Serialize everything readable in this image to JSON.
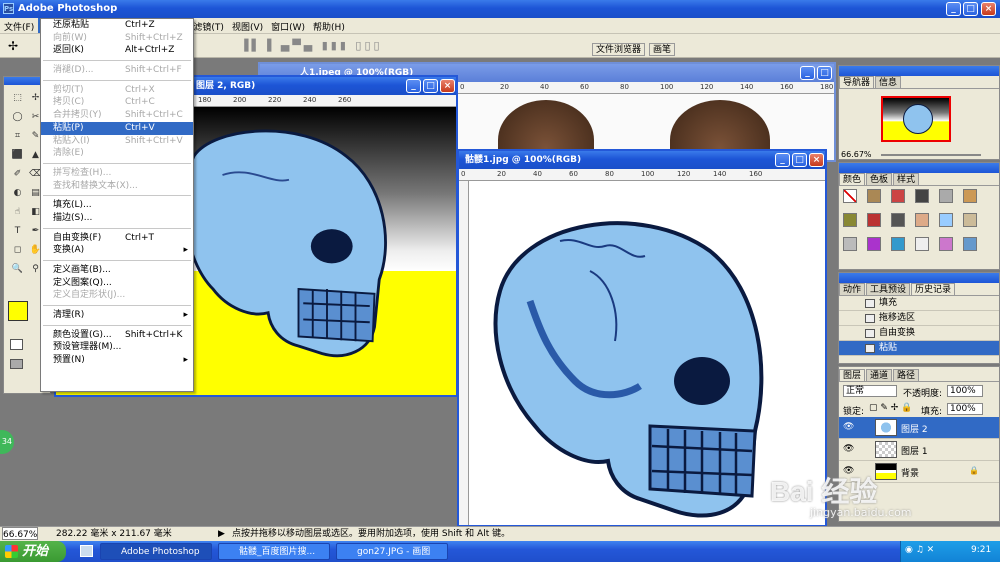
{
  "app": {
    "title": "Adobe Photoshop"
  },
  "menubar": {
    "items": [
      "文件(F)",
      "编辑(E)",
      "图像(I)",
      "图层(L)",
      "选择(S)",
      "滤镜(T)",
      "视图(V)",
      "窗口(W)",
      "帮助(H)"
    ]
  },
  "optbar": {
    "file_browser": "文件浏览器",
    "brushes": "画笔"
  },
  "edit_menu": {
    "items": [
      {
        "label": "还原粘贴",
        "shortcut": "Ctrl+Z",
        "state": "normal"
      },
      {
        "label": "向前(W)",
        "shortcut": "Shift+Ctrl+Z",
        "state": "disabled"
      },
      {
        "label": "返回(K)",
        "shortcut": "Alt+Ctrl+Z",
        "state": "normal"
      },
      {
        "sep": true
      },
      {
        "label": "消褪(D)...",
        "shortcut": "Shift+Ctrl+F",
        "state": "disabled"
      },
      {
        "sep": true
      },
      {
        "label": "剪切(T)",
        "shortcut": "Ctrl+X",
        "state": "disabled"
      },
      {
        "label": "拷贝(C)",
        "shortcut": "Ctrl+C",
        "state": "disabled"
      },
      {
        "label": "合并拷贝(Y)",
        "shortcut": "Shift+Ctrl+C",
        "state": "disabled"
      },
      {
        "label": "粘贴(P)",
        "shortcut": "Ctrl+V",
        "state": "highlight"
      },
      {
        "label": "粘贴入(I)",
        "shortcut": "Shift+Ctrl+V",
        "state": "disabled"
      },
      {
        "label": "清除(E)",
        "shortcut": "",
        "state": "disabled"
      },
      {
        "sep": true
      },
      {
        "label": "拼写检查(H)...",
        "shortcut": "",
        "state": "disabled"
      },
      {
        "label": "查找和替换文本(X)...",
        "shortcut": "",
        "state": "disabled"
      },
      {
        "sep": true
      },
      {
        "label": "填充(L)...",
        "shortcut": "",
        "state": "normal"
      },
      {
        "label": "描边(S)...",
        "shortcut": "",
        "state": "normal"
      },
      {
        "sep": true
      },
      {
        "label": "自由变换(F)",
        "shortcut": "Ctrl+T",
        "state": "normal"
      },
      {
        "label": "变换(A)",
        "shortcut": "",
        "state": "normal",
        "sub": true
      },
      {
        "sep": true
      },
      {
        "label": "定义画笔(B)...",
        "shortcut": "",
        "state": "normal"
      },
      {
        "label": "定义图案(Q)...",
        "shortcut": "",
        "state": "normal"
      },
      {
        "label": "定义自定形状(J)...",
        "shortcut": "",
        "state": "disabled"
      },
      {
        "sep": true
      },
      {
        "label": "清理(R)",
        "shortcut": "",
        "state": "normal",
        "sub": true
      },
      {
        "sep": true
      },
      {
        "label": "颜色设置(G)...",
        "shortcut": "Shift+Ctrl+K",
        "state": "normal"
      },
      {
        "label": "预设管理器(M)...",
        "shortcut": "",
        "state": "normal"
      },
      {
        "label": "预置(N)",
        "shortcut": "",
        "state": "normal",
        "sub": true
      }
    ]
  },
  "doc1": {
    "title": "图层 2, RGB)",
    "ruler": [
      "100",
      "120",
      "140",
      "160",
      "180",
      "200",
      "220",
      "240",
      "260"
    ]
  },
  "doc_bg": {
    "title": "人1.jpeg @ 100%(RGB)",
    "ruler": [
      "0",
      "20",
      "40",
      "60",
      "80",
      "100",
      "120",
      "140",
      "160",
      "180",
      "200",
      "220"
    ]
  },
  "doc2": {
    "title": "骷髅1.jpg @ 100%(RGB)",
    "ruler": [
      "0",
      "20",
      "40",
      "60",
      "80",
      "100",
      "120",
      "140",
      "160"
    ]
  },
  "navigator": {
    "tabs": [
      "导航器",
      "信息"
    ],
    "zoom": "66.67%"
  },
  "color_panel": {
    "tabs": [
      "颜色",
      "色板",
      "样式"
    ]
  },
  "history_panel": {
    "tabs": [
      "动作",
      "工具预设",
      "历史记录"
    ],
    "items": [
      "填充",
      "拖移选区",
      "自由变换",
      "粘贴"
    ]
  },
  "layers_panel": {
    "tabs": [
      "图层",
      "通道",
      "路径"
    ],
    "blend_mode": "正常",
    "opacity_label": "不透明度:",
    "opacity": "100%",
    "lock_label": "锁定:",
    "fill_label": "填充:",
    "fill": "100%",
    "layers": [
      "图层 2",
      "图层 1",
      "背景"
    ]
  },
  "status": {
    "zoom": "66.67%",
    "size": "282.22 毫米 x 211.67 毫米",
    "hint": "点按并拖移以移动图层或选区。要用附加选项，使用 Shift 和 Alt 键。"
  },
  "taskbar": {
    "start": "开始",
    "tasks": [
      "Adobe Photoshop",
      "骷髅_百度图片搜...",
      "gon27.JPG - 画图"
    ],
    "clock": "9:21"
  },
  "watermark": {
    "text": "Bai 经验",
    "url": "jingyan.baidu.com"
  },
  "colors": {
    "xp_blue": "#1d55d6",
    "highlight": "#316ac5",
    "skull_blue": "#8fc3ee",
    "yellow": "#ffff00"
  }
}
